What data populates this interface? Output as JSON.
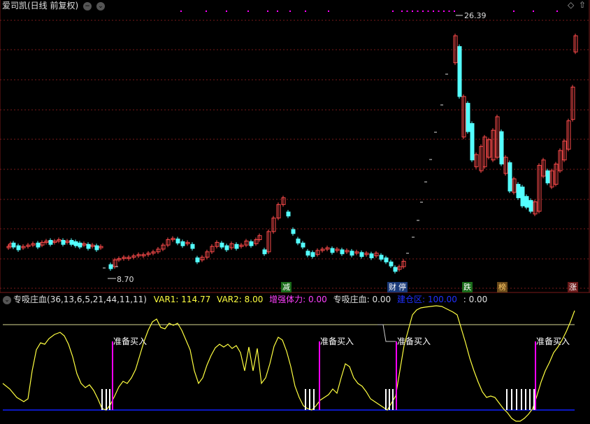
{
  "header": {
    "stock": "爱司凯(日线 前复权)",
    "minus_icon": "−",
    "chevron_icon": "⌄",
    "diamond_icon": "◇",
    "up_icon": "⇧"
  },
  "colors": {
    "up": "#ff4b4b",
    "down": "#54ffff",
    "grid": "#7a1a1a",
    "line": "#ffff40",
    "marker": "#ff00ff",
    "base": "#1020ff",
    "threshold": "#d8d890"
  },
  "price_labels": {
    "high": "26.39",
    "low": "8.70"
  },
  "event_tags": [
    {
      "text": "减",
      "bg": "#1a6b1a",
      "color": "#ffffff"
    },
    {
      "text": "财",
      "bg": "#1a3a7a",
      "color": "#ffffff"
    },
    {
      "text": "停",
      "bg": "#1a3a7a",
      "color": "#ffffff"
    },
    {
      "text": "跌",
      "bg": "#1a6b1a",
      "color": "#ffffff"
    },
    {
      "text": "榜",
      "bg": "#6b4a1a",
      "color": "#ffcc66"
    },
    {
      "text": "涨",
      "bg": "#6b1a1a",
      "color": "#ffffff"
    }
  ],
  "indicator": {
    "name": "专吸庄血",
    "params": "(36,13,6,5,21,44,11,11)",
    "values": [
      {
        "label": "VAR1:",
        "value": "114.77",
        "color": "#ffff40"
      },
      {
        "label": "VAR2:",
        "value": "8.00",
        "color": "#ffff40"
      },
      {
        "label": "增强体力:",
        "value": "0.00",
        "color": "#ff40ff"
      },
      {
        "label": "专吸庄血:",
        "value": "0.00",
        "color": "#e0e0e0"
      },
      {
        "label": "建仓区:",
        "value": "100.00",
        "color": "#2030ff"
      },
      {
        "label": ":",
        "value": "0.00",
        "color": "#e0e0e0"
      }
    ]
  },
  "signal_label": "准备买入",
  "chart_data": {
    "type": "candlestick",
    "title": "爱司凯(日线 前复权)",
    "price_marks": {
      "high": 26.39,
      "low": 8.7
    },
    "indicator_series": [
      "VAR1",
      "VAR2",
      "增强体力",
      "专吸庄血",
      "建仓区"
    ],
    "last_values": {
      "VAR1": 114.77,
      "VAR2": 8.0,
      "增强体力": 0.0,
      "专吸庄血": 0.0,
      "建仓区": 100.0
    },
    "signals": [
      "准备买入",
      "准备买入",
      "准备买入",
      "准备买入"
    ],
    "grid": true
  }
}
